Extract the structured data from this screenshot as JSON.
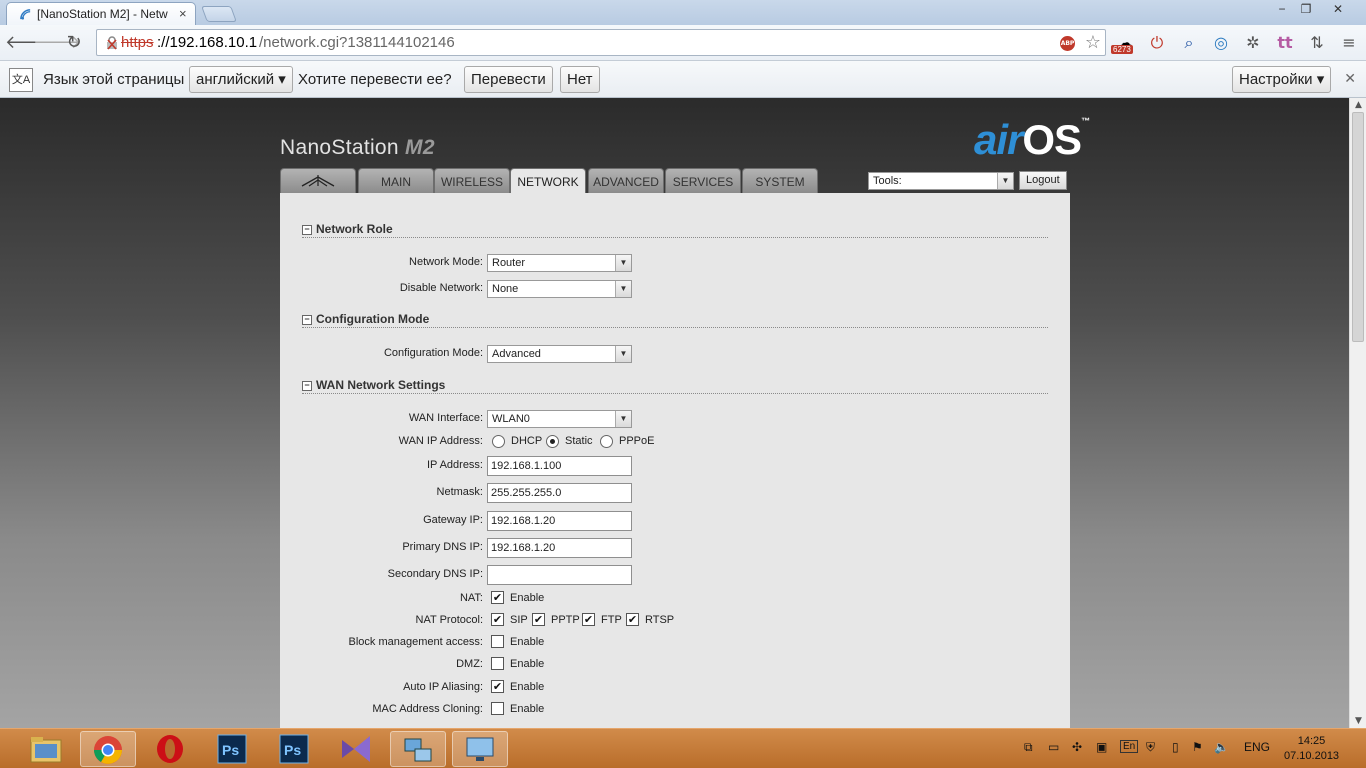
{
  "browser": {
    "tab_title": "[NanoStation M2] - Netw",
    "url_scheme": "https",
    "url_host": "://192.168.10.1",
    "url_path": "/network.cgi?1381144102146",
    "ext_badge": "6273",
    "win_controls": {
      "minimize": "−",
      "restore": "❐",
      "close": "✕"
    }
  },
  "translate_bar": {
    "label": "Язык этой страницы",
    "language": "английский",
    "question": "Хотите перевести ее?",
    "translate_btn": "Перевести",
    "no_btn": "Нет",
    "settings_btn": "Настройки"
  },
  "header": {
    "brand": "NanoStation",
    "brand_model": "M2",
    "airos_air": "air",
    "airos_os": "OS",
    "airos_tm": "™"
  },
  "nav": {
    "tabs": [
      "MAIN",
      "WIRELESS",
      "NETWORK",
      "ADVANCED",
      "SERVICES",
      "SYSTEM"
    ],
    "active": "NETWORK",
    "tools_placeholder": "Tools:",
    "logout": "Logout"
  },
  "sections": {
    "network_role": {
      "title": "Network Role",
      "network_mode_label": "Network Mode:",
      "network_mode_value": "Router",
      "disable_network_label": "Disable Network:",
      "disable_network_value": "None"
    },
    "config_mode": {
      "title": "Configuration Mode",
      "label": "Configuration Mode:",
      "value": "Advanced"
    },
    "wan": {
      "title": "WAN Network Settings",
      "interface_label": "WAN Interface:",
      "interface_value": "WLAN0",
      "ip_mode_label": "WAN IP Address:",
      "ip_modes": [
        "DHCP",
        "Static",
        "PPPoE"
      ],
      "ip_mode_selected": "Static",
      "ip_label": "IP Address:",
      "ip_value": "192.168.1.100",
      "netmask_label": "Netmask:",
      "netmask_value": "255.255.255.0",
      "gateway_label": "Gateway IP:",
      "gateway_value": "192.168.1.20",
      "dns1_label": "Primary DNS IP:",
      "dns1_value": "192.168.1.20",
      "dns2_label": "Secondary DNS IP:",
      "dns2_value": "",
      "nat_label": "NAT:",
      "nat_enable": "Enable",
      "nat_enabled": true,
      "nat_protocol_label": "NAT Protocol:",
      "nat_protocols": [
        "SIP",
        "PPTP",
        "FTP",
        "RTSP"
      ],
      "block_mgmt_label": "Block management access:",
      "block_mgmt_enable": "Enable",
      "dmz_label": "DMZ:",
      "dmz_enable": "Enable",
      "auto_ip_label": "Auto IP Aliasing:",
      "auto_ip_enable": "Enable",
      "mac_clone_label": "MAC Address Cloning:",
      "mac_clone_enable": "Enable"
    }
  },
  "taskbar": {
    "lang": "ENG",
    "time": "14:25",
    "date": "07.10.2013",
    "tray_en": "En"
  }
}
